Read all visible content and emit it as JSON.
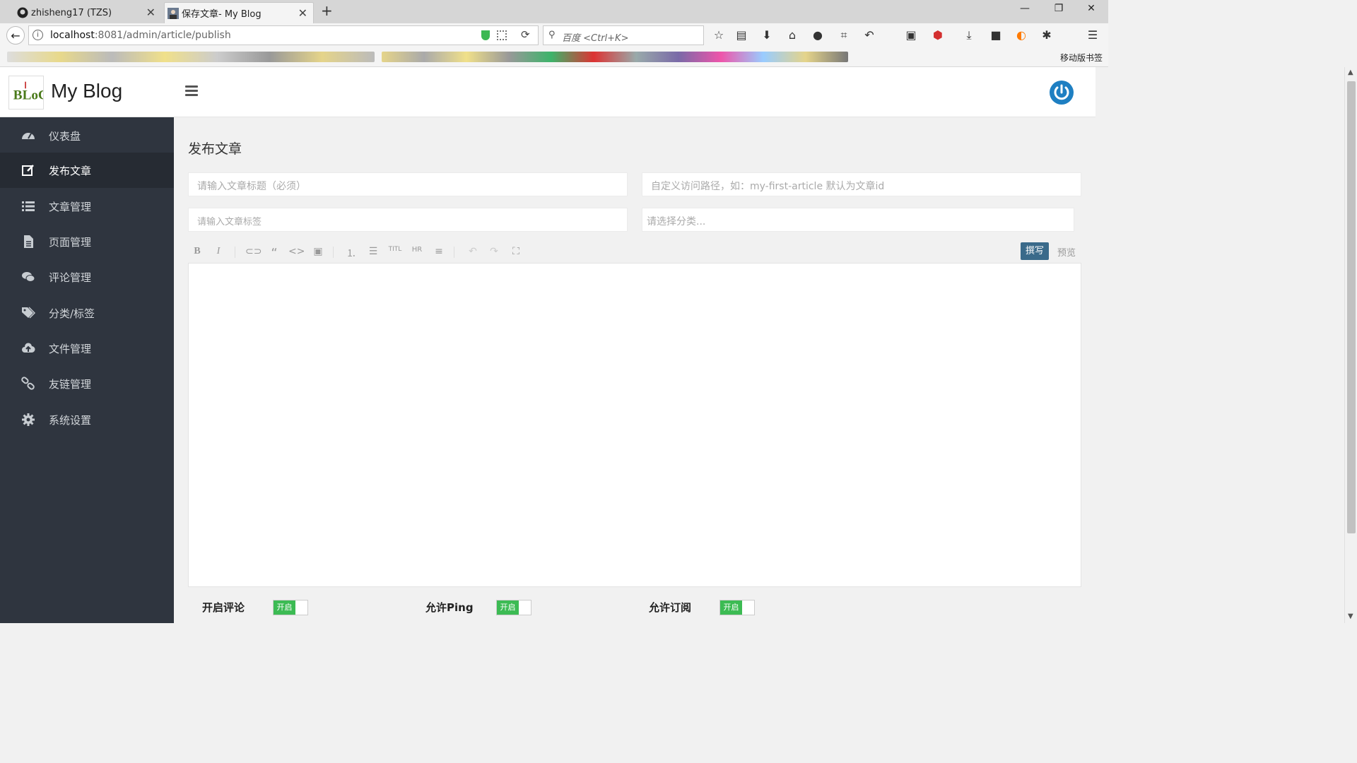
{
  "browser": {
    "tabs": [
      {
        "title": "zhisheng17 (TZS)",
        "favicon": "github-icon"
      },
      {
        "title": "保存文章- My Blog",
        "favicon": "avatar-icon"
      }
    ],
    "url_host": "localhost",
    "url_path": ":8081/admin/article/publish",
    "search_placeholder": "百度 <Ctrl+K>",
    "mobile_bookmarks": "移动版书签"
  },
  "app": {
    "brand": "My Blog",
    "colors": {
      "sidebar": "#2f353f",
      "active": "#262b33",
      "accent": "#3a6a8a",
      "toggle_on": "#3cbb53",
      "power": "#1e7fc2"
    }
  },
  "sidebar": {
    "items": [
      {
        "label": "仪表盘",
        "icon": "dashboard-icon"
      },
      {
        "label": "发布文章",
        "icon": "edit-icon",
        "active": true
      },
      {
        "label": "文章管理",
        "icon": "list-icon"
      },
      {
        "label": "页面管理",
        "icon": "file-icon"
      },
      {
        "label": "评论管理",
        "icon": "comments-icon"
      },
      {
        "label": "分类/标签",
        "icon": "tags-icon"
      },
      {
        "label": "文件管理",
        "icon": "cloud-upload-icon"
      },
      {
        "label": "友链管理",
        "icon": "link-icon"
      },
      {
        "label": "系统设置",
        "icon": "gear-icon"
      }
    ]
  },
  "main": {
    "title": "发布文章",
    "title_placeholder": "请输入文章标题（必须）",
    "slug_placeholder": "自定义访问路径，如：my-first-article  默认为文章id",
    "tags_placeholder": "请输入文章标签",
    "category_placeholder": "请选择分类...",
    "editor": {
      "write_label": "撰写",
      "preview_label": "预览",
      "tools": [
        "bold-icon",
        "italic-icon",
        "link-icon",
        "quote-icon",
        "code-icon",
        "image-icon",
        "ordered-list-icon",
        "unordered-list-icon",
        "title-icon",
        "hr-icon",
        "page-break-icon",
        "undo-icon",
        "redo-icon",
        "fullscreen-icon"
      ]
    },
    "options": [
      {
        "label": "开启评论",
        "state": "开启"
      },
      {
        "label": "允许Ping",
        "state": "开启"
      },
      {
        "label": "允许订阅",
        "state": "开启"
      }
    ]
  }
}
